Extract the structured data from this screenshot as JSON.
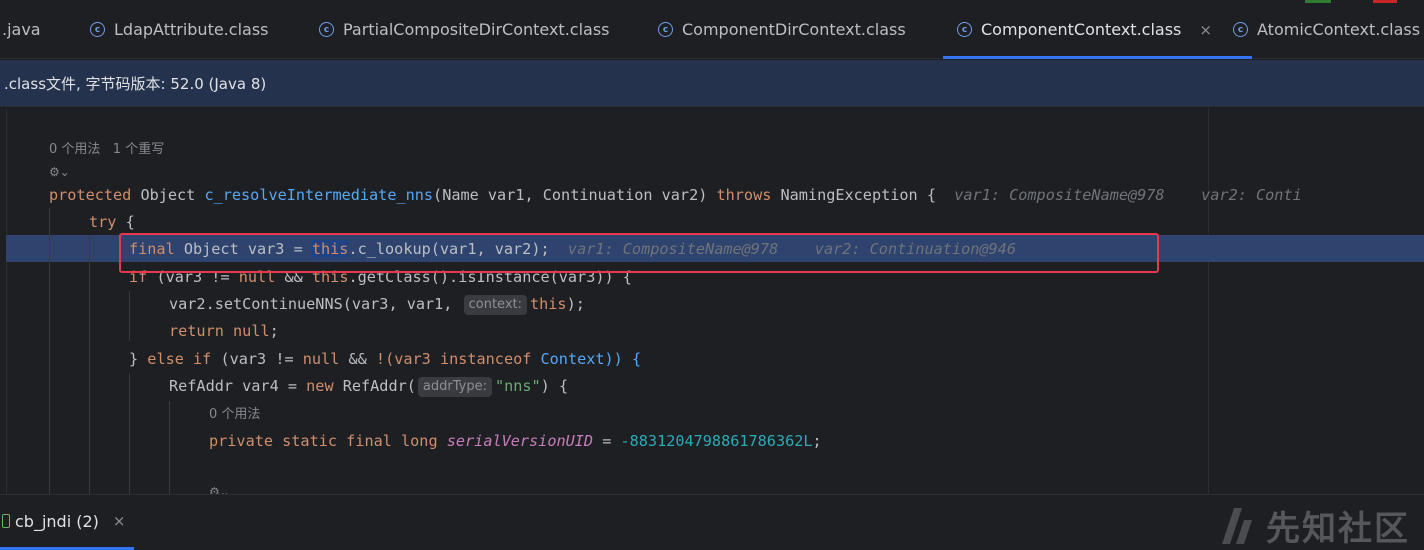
{
  "tabs": [
    {
      "label": ".java",
      "icon": "none"
    },
    {
      "label": "LdapAttribute.class",
      "icon": "class-icon"
    },
    {
      "label": "PartialCompositeDirContext.class",
      "icon": "class-icon"
    },
    {
      "label": "ComponentDirContext.class",
      "icon": "class-icon"
    },
    {
      "label": "ComponentContext.class",
      "icon": "class-icon",
      "active": true,
      "close": "×"
    },
    {
      "label": "AtomicContext.class",
      "icon": "class-icon"
    }
  ],
  "banner": {
    "text": ".class文件, 字节码版本: 52.0 (Java 8)"
  },
  "editor": {
    "usage_hint_1": "0 个用法   1 个重写",
    "method_sig": {
      "kw": "protected",
      "type": " Object ",
      "name": "c_resolveIntermediate_nns",
      "params": "(Name var1, Continuation var2) ",
      "throws": "throws",
      "exc": " NamingException {",
      "inline": "var1: CompositeName@978    var2: Conti"
    },
    "try_kw": "try",
    "try_brace": " {",
    "line3": {
      "kw_final": "final",
      "rest1": " Object var3 = ",
      "this": "this",
      "rest2": ".c_lookup(var1, var2);",
      "inline": "var1: CompositeName@978    var2: Continuation@946"
    },
    "line4": {
      "kw_if": "if",
      "p1": " (var3 != ",
      "kw_null": "null",
      "p2": " && ",
      "kw_this": "this",
      "p3": ".getClass().isInstance(var3)) {"
    },
    "line5": {
      "p1": "var2.setContinueNNS(var3, var1, ",
      "hint": "context:",
      "kw_this": "this",
      "p2": ");"
    },
    "line6": {
      "kw_return": "return",
      "kw_null": "null",
      "semi": ";"
    },
    "line7": {
      "p1": "} ",
      "kw_else": "else",
      "kw_if": "if",
      "p2": " (var3 != ",
      "kw_null": "null",
      "p3": " && ",
      "p4": "!(var3 ",
      "kw_instanceof": "instanceof",
      "p5": " Context)) {"
    },
    "line8": {
      "p1": "RefAddr var4 = ",
      "kw_new": "new",
      "p2": " RefAddr(",
      "hint": "addrType:",
      "str": "\"nns\"",
      "p3": ") {"
    },
    "usage_hint_2": "0 个用法",
    "line9": {
      "kw": "private static final long",
      "field": "serialVersionUID",
      "eq": " = ",
      "num": "-8831204798861786362L",
      "semi": ";"
    }
  },
  "run": {
    "label": "cb_jndi (2)",
    "close": "×"
  },
  "watermark": "先知社区",
  "colors": {
    "accent": "#3574f0",
    "highlight_box": "#e8384c",
    "exec_line": "#2e436e",
    "keyword": "#cf8e6d",
    "function": "#56a8f5"
  }
}
